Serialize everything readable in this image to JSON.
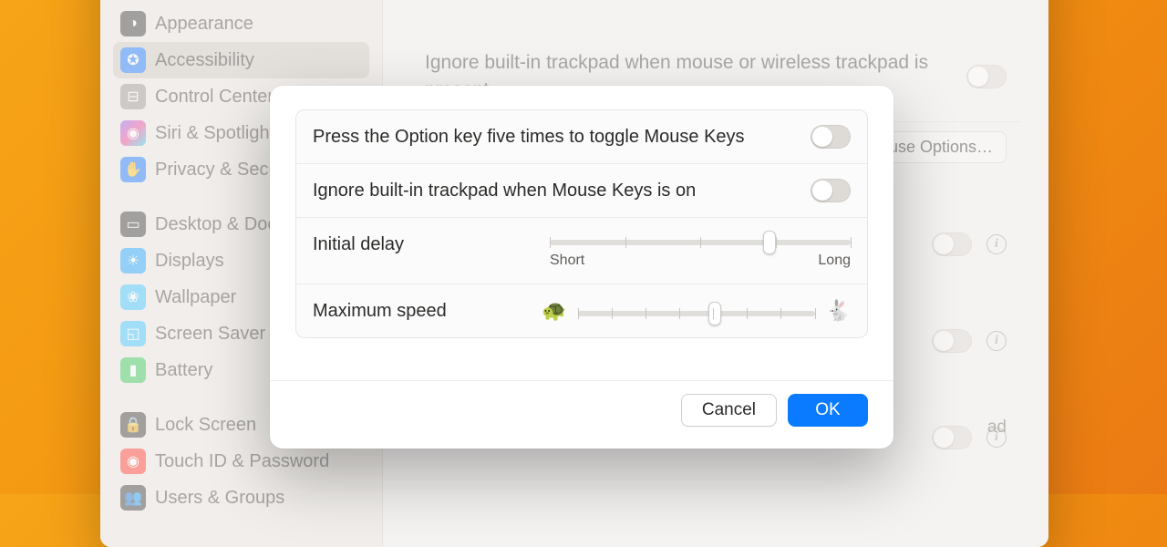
{
  "sidebar": {
    "items": [
      {
        "label": "Appearance",
        "icon": "◑",
        "color": "#3d3d3d"
      },
      {
        "label": "Accessibility",
        "icon": "✪",
        "color": "#1478ff",
        "selected": true
      },
      {
        "label": "Control Center",
        "icon": "⊟",
        "color": "#9a9793"
      },
      {
        "label": "Siri & Spotlight",
        "icon": "◉",
        "color": "linear-gradient(135deg,#8b5cf6,#ec4899,#22d3ee)"
      },
      {
        "label": "Privacy & Security",
        "icon": "✋",
        "color": "#1478ff"
      }
    ],
    "items2": [
      {
        "label": "Desktop & Dock",
        "icon": "▭",
        "color": "#3d3d3d"
      },
      {
        "label": "Displays",
        "icon": "☀",
        "color": "#1ea4ff"
      },
      {
        "label": "Wallpaper",
        "icon": "❀",
        "color": "#3cc6ff"
      },
      {
        "label": "Screen Saver",
        "icon": "◱",
        "color": "#3cc6ff"
      },
      {
        "label": "Battery",
        "icon": "▮",
        "color": "#33c759"
      }
    ],
    "items3": [
      {
        "label": "Lock Screen",
        "icon": "🔒",
        "color": "#3d3d3d"
      },
      {
        "label": "Touch ID & Password",
        "icon": "◉",
        "color": "#ff3b30"
      },
      {
        "label": "Users & Groups",
        "icon": "👥",
        "color": "#3d3d3d"
      }
    ]
  },
  "background": {
    "row1_label": "Ignore built-in trackpad when mouse or wireless trackpad is present",
    "mouse_options_label": "Mouse Options…",
    "hidden_row_tail": "ad"
  },
  "modal": {
    "row1_label": "Press the Option key five times to toggle Mouse Keys",
    "row1_on": false,
    "row2_label": "Ignore built-in trackpad when Mouse Keys is on",
    "row2_on": false,
    "row3_label": "Initial delay",
    "row3_min_label": "Short",
    "row3_max_label": "Long",
    "row3_percent": 73,
    "row4_label": "Maximum speed",
    "row4_percent": 58,
    "cancel_label": "Cancel",
    "ok_label": "OK"
  }
}
